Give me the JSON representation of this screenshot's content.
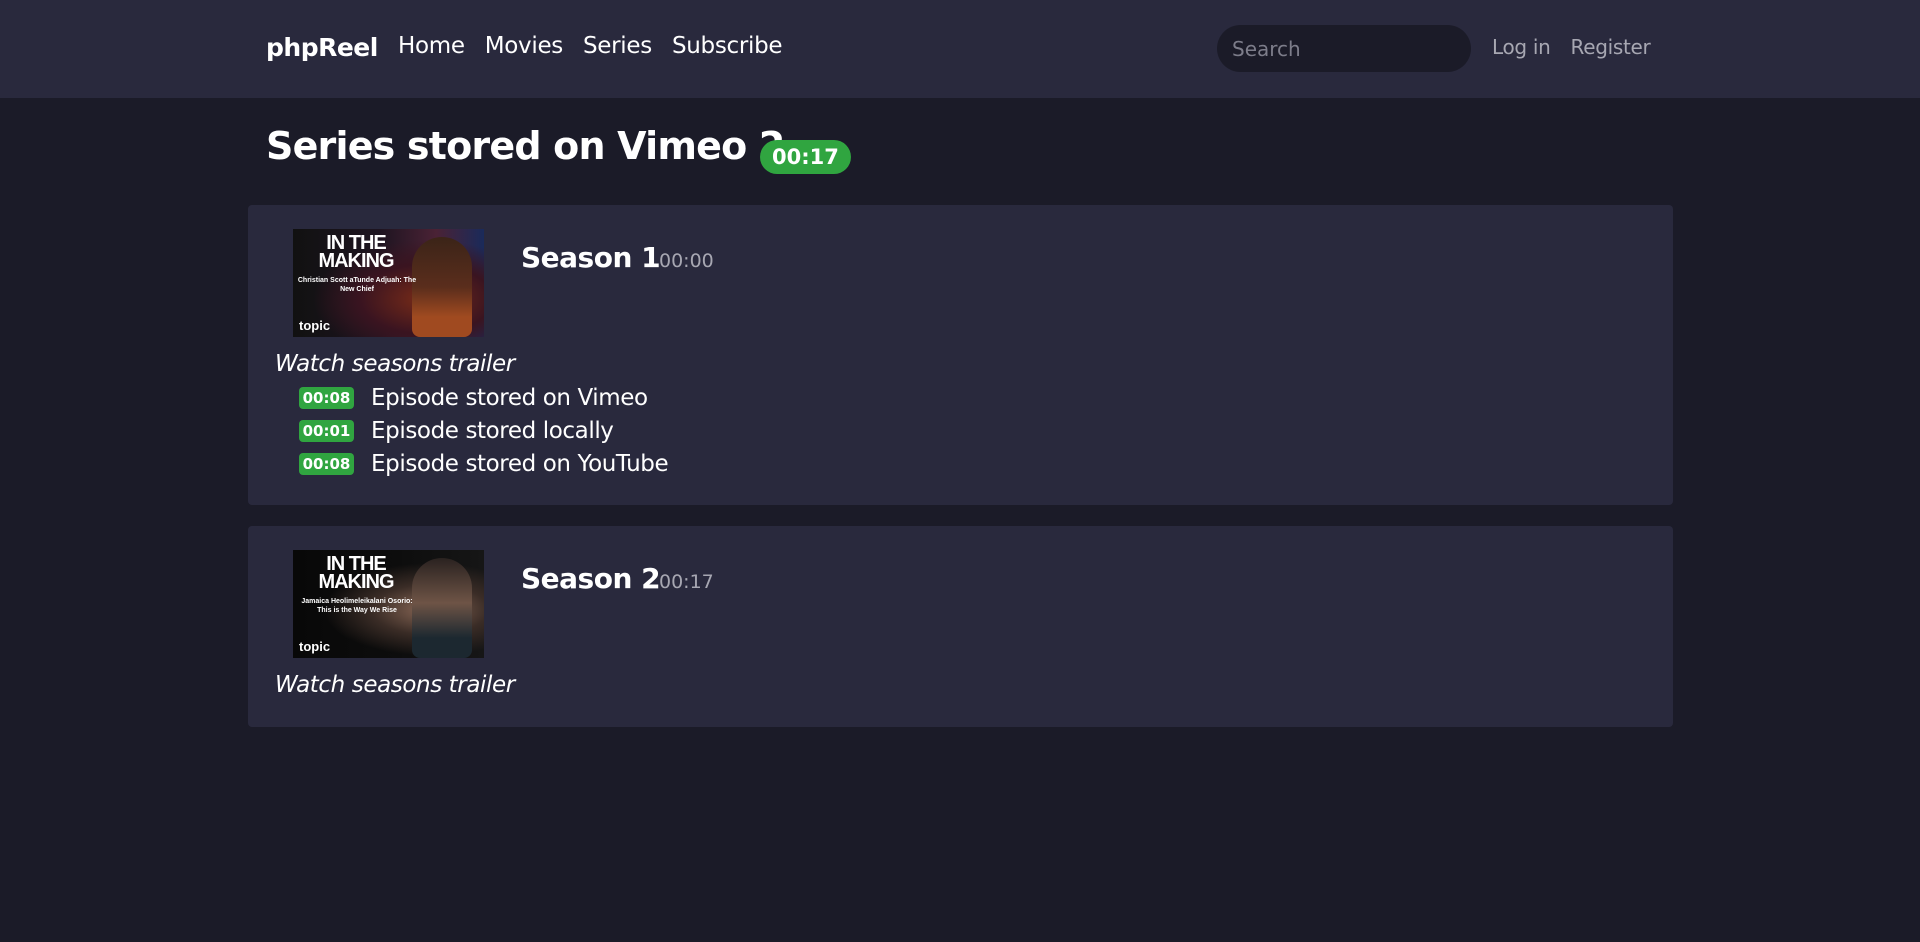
{
  "navbar": {
    "brand": "phpReel",
    "links": [
      "Home",
      "Movies",
      "Series",
      "Subscribe"
    ],
    "search_placeholder": "Search",
    "auth": {
      "login": "Log in",
      "register": "Register"
    }
  },
  "page": {
    "title": "Series stored on Vimeo 2",
    "duration": "00:17"
  },
  "seasons": [
    {
      "title": "Season 1",
      "duration": "00:00",
      "trailer_label": "Watch seasons trailer",
      "thumbnail": {
        "headline": "IN THE MAKING",
        "subtitle": "Christian Scott aTunde Adjuah: The New Chief",
        "brand": "topic"
      },
      "episodes": [
        {
          "duration": "00:08",
          "title": "Episode stored on Vimeo"
        },
        {
          "duration": "00:01",
          "title": "Episode stored locally"
        },
        {
          "duration": "00:08",
          "title": "Episode stored on YouTube"
        }
      ]
    },
    {
      "title": "Season 2",
      "duration": "00:17",
      "trailer_label": "Watch seasons trailer",
      "thumbnail": {
        "headline": "IN THE MAKING",
        "subtitle": "Jamaica Heolimeleikalani Osorio: This is the Way We Rise",
        "brand": "topic"
      },
      "episodes": []
    }
  ],
  "colors": {
    "background": "#1b1b28",
    "surface": "#29293d",
    "accent_green": "#30a540",
    "muted_text": "#a7a7b2"
  }
}
